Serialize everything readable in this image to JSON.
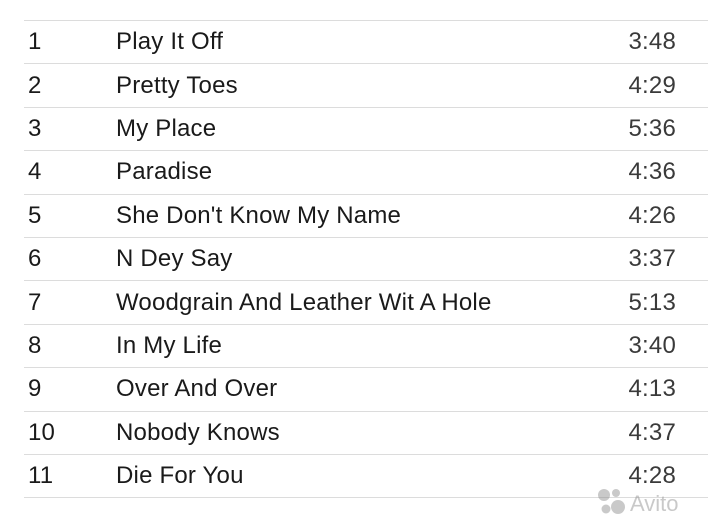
{
  "tracks": [
    {
      "number": "1",
      "title": "Play It Off",
      "duration": "3:48"
    },
    {
      "number": "2",
      "title": "Pretty Toes",
      "duration": "4:29"
    },
    {
      "number": "3",
      "title": "My Place",
      "duration": "5:36"
    },
    {
      "number": "4",
      "title": "Paradise",
      "duration": "4:36"
    },
    {
      "number": "5",
      "title": "She Don't Know My Name",
      "duration": "4:26"
    },
    {
      "number": "6",
      "title": "N Dey Say",
      "duration": "3:37"
    },
    {
      "number": "7",
      "title": "Woodgrain And Leather Wit A Hole",
      "duration": "5:13"
    },
    {
      "number": "8",
      "title": "In My Life",
      "duration": "3:40"
    },
    {
      "number": "9",
      "title": "Over And Over",
      "duration": "4:13"
    },
    {
      "number": "10",
      "title": "Nobody Knows",
      "duration": "4:37"
    },
    {
      "number": "11",
      "title": "Die For You",
      "duration": "4:28"
    }
  ],
  "watermark": {
    "text": "Avito"
  },
  "colors": {
    "divider": "#dcdcdc",
    "text": "#1a1a1a"
  }
}
